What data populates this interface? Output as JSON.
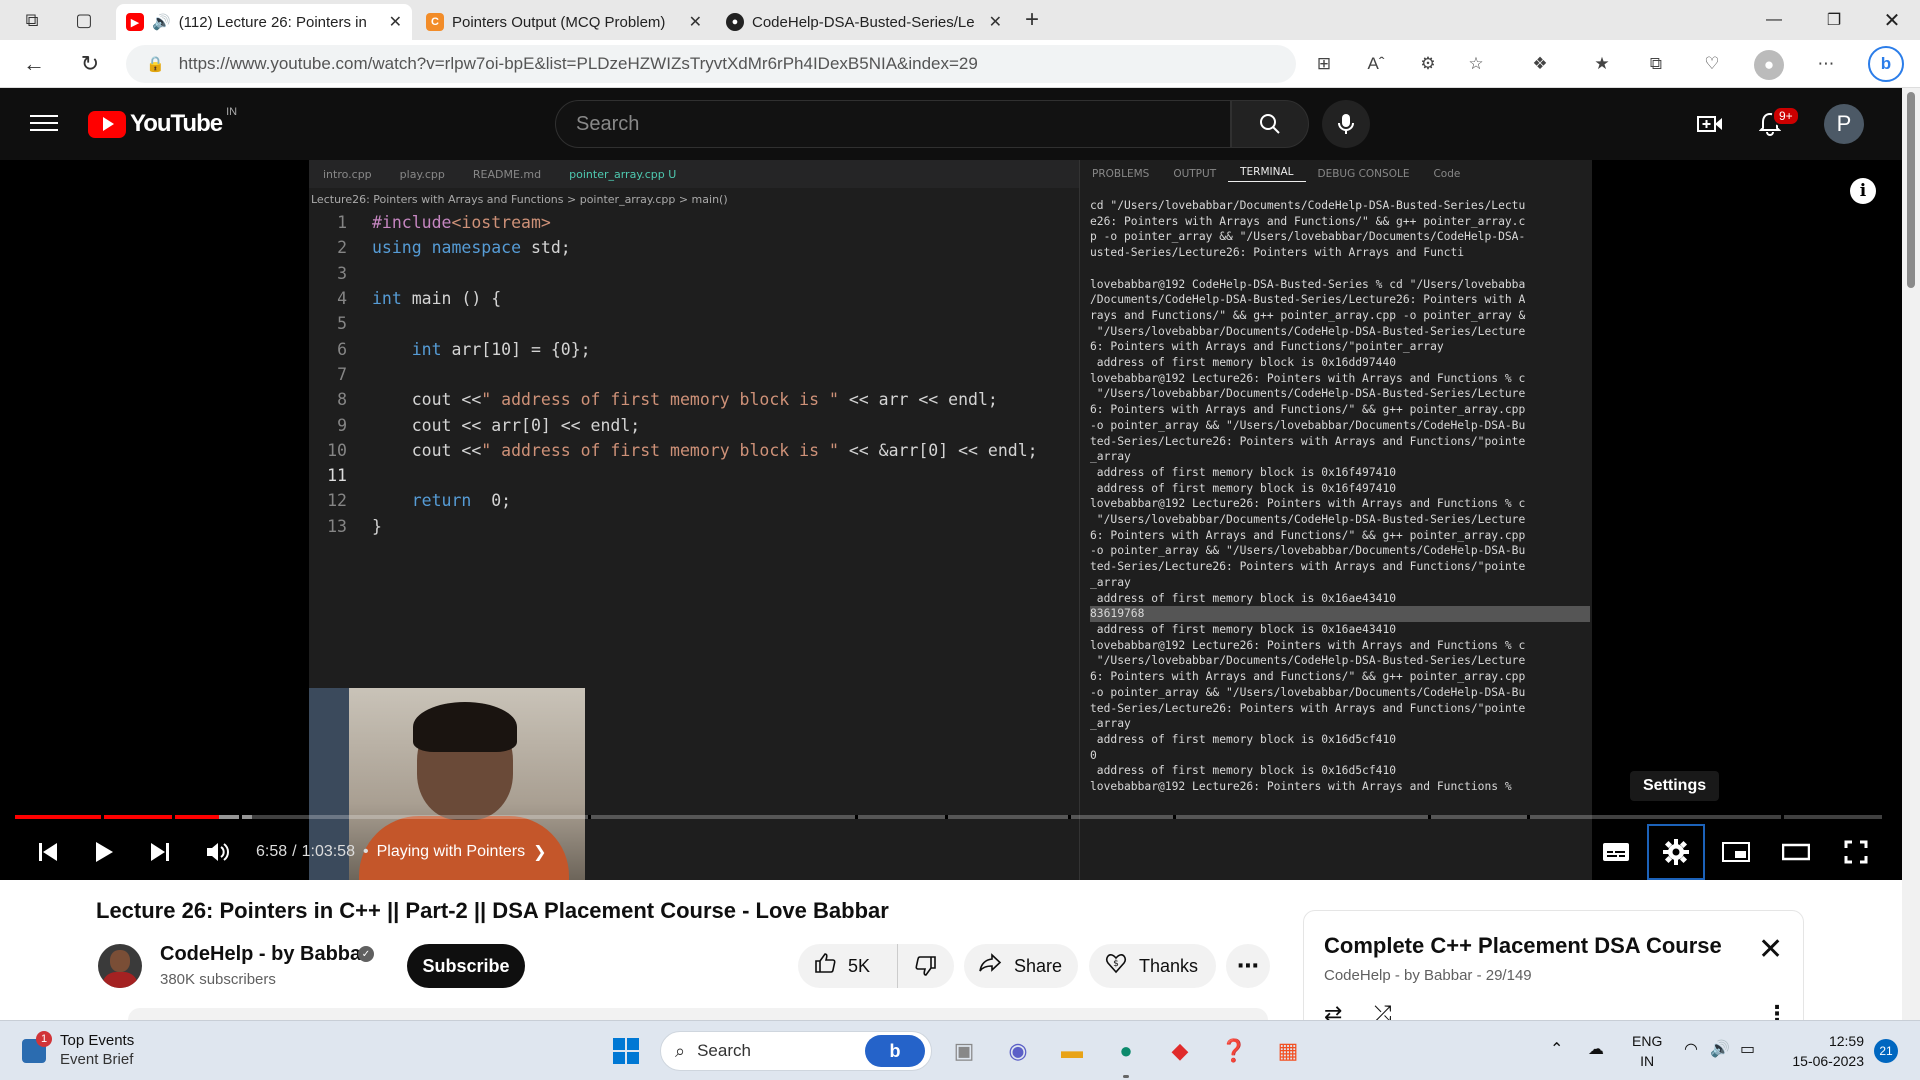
{
  "browser": {
    "tabs": [
      {
        "title": "(112) Lecture 26: Pointers in",
        "icon": "youtube-icon",
        "active": true,
        "audio": true
      },
      {
        "title": "Pointers Output (MCQ Problem)",
        "icon": "codehelp-icon",
        "active": false
      },
      {
        "title": "CodeHelp-DSA-Busted-Series/Le",
        "icon": "github-icon",
        "active": false
      }
    ],
    "url": "https://www.youtube.com/watch?v=rlpw7oi-bpE&list=PLDzeHZWIZsTryvtXdMr6rPh4IDexB5NIA&index=29"
  },
  "youtube": {
    "logo_text": "YouTube",
    "country_code": "IN",
    "search_placeholder": "Search",
    "notification_badge": "9+",
    "avatar_letter": "P"
  },
  "video": {
    "editor_tabs": [
      "intro.cpp",
      "play.cpp",
      "README.md",
      "pointer_array.cpp U"
    ],
    "breadcrumb": "Lecture26: Pointers with Arrays and Functions  >  pointer_array.cpp  >  main()",
    "code_lines": [
      {
        "n": "1",
        "tokens": [
          [
            "pp",
            "#include"
          ],
          [
            "str",
            "<iostream>"
          ]
        ]
      },
      {
        "n": "2",
        "tokens": [
          [
            "kw",
            "using"
          ],
          [
            "txt",
            " "
          ],
          [
            "kw",
            "namespace"
          ],
          [
            "txt",
            " std;"
          ]
        ]
      },
      {
        "n": "3",
        "tokens": []
      },
      {
        "n": "4",
        "tokens": [
          [
            "kw",
            "int"
          ],
          [
            "txt",
            " main () {"
          ]
        ]
      },
      {
        "n": "5",
        "tokens": []
      },
      {
        "n": "6",
        "tokens": [
          [
            "txt",
            "    "
          ],
          [
            "kw",
            "int"
          ],
          [
            "txt",
            " arr[10] = {0};"
          ]
        ]
      },
      {
        "n": "7",
        "tokens": []
      },
      {
        "n": "8",
        "tokens": [
          [
            "txt",
            "    cout <<"
          ],
          [
            "str",
            "\" address of first memory block is \""
          ],
          [
            "txt",
            " << arr << endl;"
          ]
        ]
      },
      {
        "n": "9",
        "tokens": [
          [
            "txt",
            "    cout << arr[0] << endl;"
          ]
        ]
      },
      {
        "n": "10",
        "tokens": [
          [
            "txt",
            "    cout <<"
          ],
          [
            "str",
            "\" address of first memory block is \""
          ],
          [
            "txt",
            " << &arr[0] << endl;"
          ]
        ]
      },
      {
        "n": "11",
        "tokens": []
      },
      {
        "n": "12",
        "tokens": [
          [
            "txt",
            "    "
          ],
          [
            "kw",
            "return"
          ],
          [
            "txt",
            "  0;"
          ]
        ]
      },
      {
        "n": "13",
        "tokens": [
          [
            "txt",
            "}"
          ]
        ]
      }
    ],
    "current_line": "11",
    "terminal_tabs": [
      "PROBLEMS",
      "OUTPUT",
      "TERMINAL",
      "DEBUG CONSOLE",
      "Code"
    ],
    "terminal_lines": [
      "cd \"/Users/lovebabbar/Documents/CodeHelp-DSA-Busted-Series/Lectu",
      "e26: Pointers with Arrays and Functions/\" && g++ pointer_array.c",
      "p -o pointer_array && \"/Users/lovebabbar/Documents/CodeHelp-DSA-",
      "usted-Series/Lecture26: Pointers with Arrays and Functi",
      "",
      "lovebabbar@192 CodeHelp-DSA-Busted-Series % cd \"/Users/lovebabba",
      "/Documents/CodeHelp-DSA-Busted-Series/Lecture26: Pointers with A",
      "rays and Functions/\" && g++ pointer_array.cpp -o pointer_array &",
      " \"/Users/lovebabbar/Documents/CodeHelp-DSA-Busted-Series/Lecture",
      "6: Pointers with Arrays and Functions/\"pointer_array",
      " address of first memory block is 0x16dd97440",
      "lovebabbar@192 Lecture26: Pointers with Arrays and Functions % c",
      " \"/Users/lovebabbar/Documents/CodeHelp-DSA-Busted-Series/Lecture",
      "6: Pointers with Arrays and Functions/\" && g++ pointer_array.cpp",
      "-o pointer_array && \"/Users/lovebabbar/Documents/CodeHelp-DSA-Bu",
      "ted-Series/Lecture26: Pointers with Arrays and Functions/\"pointe",
      "_array",
      " address of first memory block is 0x16f497410",
      " address of first memory block is 0x16f497410",
      "lovebabbar@192 Lecture26: Pointers with Arrays and Functions % c",
      " \"/Users/lovebabbar/Documents/CodeHelp-DSA-Busted-Series/Lecture",
      "6: Pointers with Arrays and Functions/\" && g++ pointer_array.cpp",
      "-o pointer_array && \"/Users/lovebabbar/Documents/CodeHelp-DSA-Bu",
      "ted-Series/Lecture26: Pointers with Arrays and Functions/\"pointe",
      "_array",
      " address of first memory block is 0x16ae43410",
      "83619768",
      " address of first memory block is 0x16ae43410",
      "lovebabbar@192 Lecture26: Pointers with Arrays and Functions % c",
      " \"/Users/lovebabbar/Documents/CodeHelp-DSA-Busted-Series/Lecture",
      "6: Pointers with Arrays and Functions/\" && g++ pointer_array.cpp",
      "-o pointer_array && \"/Users/lovebabbar/Documents/CodeHelp-DSA-Bu",
      "ted-Series/Lecture26: Pointers with Arrays and Functions/\"pointe",
      "_array",
      " address of first memory block is 0x16d5cf410",
      "0",
      " address of first memory block is 0x16d5cf410",
      "lovebabbar@192 Lecture26: Pointers with Arrays and Functions % "
    ],
    "settings_tooltip": "Settings",
    "time_current": "6:58",
    "time_total": "1:03:58",
    "chapter": "Playing with Pointers",
    "progress_played": 0.109,
    "progress_loaded": 0.127
  },
  "details": {
    "title": "Lecture 26: Pointers in C++ || Part-2 || DSA Placement Course - Love Babbar",
    "channel": "CodeHelp - by Babbar",
    "subscribers": "380K subscribers",
    "subscribe_label": "Subscribe",
    "likes": "5K",
    "share_label": "Share",
    "thanks_label": "Thanks"
  },
  "playlist": {
    "title": "Complete C++ Placement DSA Course",
    "meta": "CodeHelp - by Babbar - 29/149"
  },
  "taskbar": {
    "weather_title": "Top Events",
    "weather_sub": "Event Brief",
    "weather_badge": "1",
    "search_label": "Search",
    "lang_top": "ENG",
    "lang_bottom": "IN",
    "time": "12:59",
    "date": "15-06-2023",
    "notification_count": "21"
  },
  "colors": {
    "youtube_red": "#ff0000",
    "player_bg": "#000000",
    "progress_red": "#ff0000",
    "settings_focus": "#1c62b9"
  }
}
